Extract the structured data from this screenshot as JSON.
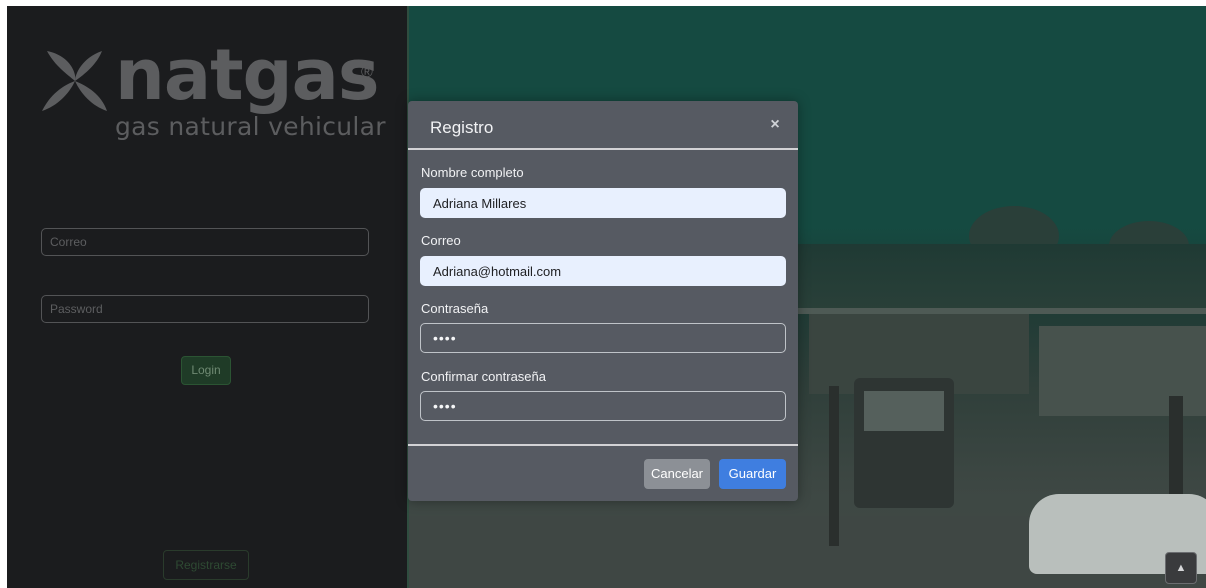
{
  "brand": {
    "name": "natgas",
    "registered_mark": "®",
    "tagline": "gas natural vehicular",
    "logo_icon": "leaf-x-icon"
  },
  "login": {
    "email_placeholder": "Correo",
    "password_placeholder": "Password",
    "login_label": "Login",
    "register_label": "Registrarse"
  },
  "modal": {
    "title": "Registro",
    "close_glyph": "×",
    "fields": {
      "full_name": {
        "label": "Nombre completo",
        "value": "Adriana Millares"
      },
      "email": {
        "label": "Correo",
        "value": "Adriana@hotmail.com"
      },
      "password": {
        "label": "Contraseña",
        "value": "••••"
      },
      "confirm_password": {
        "label": "Confirmar contraseña",
        "value": "••••"
      }
    },
    "cancel_label": "Cancelar",
    "save_label": "Guardar"
  },
  "scroll_top": {
    "glyph": "▲",
    "icon": "chevron-up-icon"
  },
  "colors": {
    "left_panel": "#1b1c1e",
    "modal_bg": "#565a62",
    "primary": "#3f7ee0",
    "secondary": "#8c9096",
    "success_dark": "#1f3b27"
  }
}
